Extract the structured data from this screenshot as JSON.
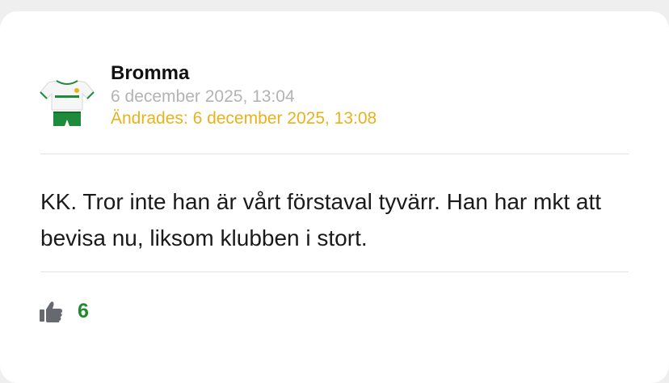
{
  "post": {
    "author": "Bromma",
    "timestamp": "6 december 2025, 13:04",
    "edited": "Ändrades: 6 december 2025, 13:08",
    "body": "KK. Tror inte han är vårt förstaval tyvärr. Han har mkt att bevisa nu, liksom klubben i stort.",
    "avatar_icon": "football-jersey-icon",
    "like_icon": "thumbs-up-icon",
    "likes": "6"
  },
  "colors": {
    "author": "#111111",
    "timestamp": "#b3b3b3",
    "edited": "#e8b21c",
    "likes": "#1f8a2e",
    "jersey_green": "#1e8a3c"
  }
}
